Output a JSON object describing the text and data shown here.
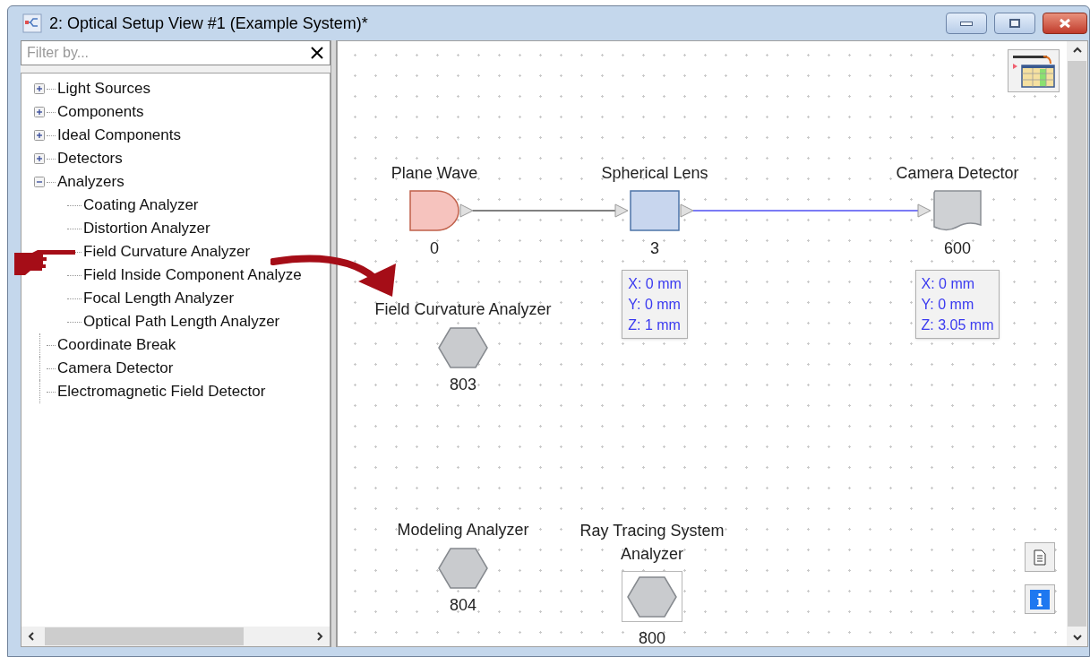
{
  "window": {
    "title": "2: Optical Setup View #1 (Example System)*"
  },
  "filter": {
    "placeholder": "Filter by..."
  },
  "tree": [
    {
      "label": "Light Sources",
      "expanded": false
    },
    {
      "label": "Components",
      "expanded": false
    },
    {
      "label": "Ideal Components",
      "expanded": false
    },
    {
      "label": "Detectors",
      "expanded": false
    },
    {
      "label": "Analyzers",
      "expanded": true,
      "children": [
        {
          "label": "Coating Analyzer"
        },
        {
          "label": "Distortion Analyzer"
        },
        {
          "label": "Field Curvature Analyzer"
        },
        {
          "label": "Field Inside Component Analyze"
        },
        {
          "label": "Focal Length Analyzer"
        },
        {
          "label": "Optical Path Length Analyzer"
        }
      ]
    },
    {
      "label": "Coordinate Break"
    },
    {
      "label": "Camera Detector"
    },
    {
      "label": "Electromagnetic Field Detector"
    }
  ],
  "nodes": [
    {
      "kind": "source",
      "label": "Plane Wave",
      "id": "0",
      "selected": false
    },
    {
      "kind": "lens",
      "label": "Spherical Lens",
      "id": "3",
      "selected": false,
      "position": [
        "X: 0 mm",
        "Y: 0 mm",
        "Z: 1 mm"
      ]
    },
    {
      "kind": "detector",
      "label": "Camera Detector",
      "id": "600",
      "selected": false,
      "position": [
        "X: 0 mm",
        "Y: 0 mm",
        "Z: 3.05 mm"
      ]
    },
    {
      "kind": "analyzer",
      "label": "Field Curvature Analyzer",
      "id": "803",
      "selected": false
    },
    {
      "kind": "analyzer",
      "label": "Modeling Analyzer",
      "id": "804",
      "selected": false
    },
    {
      "kind": "analyzer",
      "label": "Ray Tracing System Analyzer",
      "id": "800",
      "selected": true
    }
  ],
  "links": [
    {
      "color": "#808080"
    },
    {
      "color": "#7b7bf5"
    }
  ]
}
